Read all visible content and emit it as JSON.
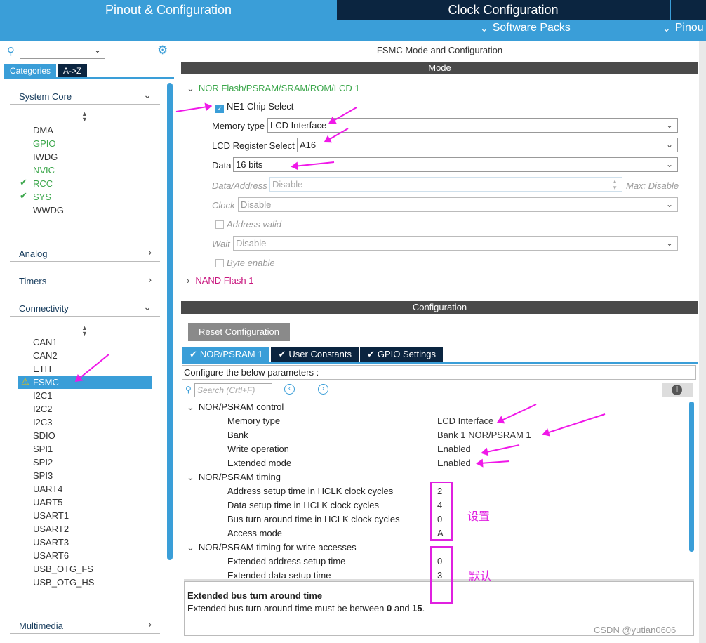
{
  "tabs": {
    "pinout": "Pinout & Configuration",
    "clock": "Clock Configuration",
    "software_packs": "Software Packs",
    "pinout_view": "Pinou"
  },
  "left": {
    "categories": "Categories",
    "az": "A->Z",
    "system_core": "System Core",
    "system_items": [
      "DMA",
      "GPIO",
      "IWDG",
      "NVIC",
      "RCC",
      "SYS",
      "WWDG"
    ],
    "analog": "Analog",
    "timers": "Timers",
    "connectivity": "Connectivity",
    "conn_items": [
      "CAN1",
      "CAN2",
      "ETH",
      "FSMC",
      "I2C1",
      "I2C2",
      "I2C3",
      "SDIO",
      "SPI1",
      "SPI2",
      "SPI3",
      "UART4",
      "UART5",
      "USART1",
      "USART2",
      "USART3",
      "USART6",
      "USB_OTG_FS",
      "USB_OTG_HS"
    ],
    "multimedia": "Multimedia"
  },
  "mode": {
    "title": "FSMC Mode and Configuration",
    "header": "Mode",
    "nor": "NOR Flash/PSRAM/SRAM/ROM/LCD 1",
    "ne1": "NE1 Chip Select",
    "memtype_label": "Memory type",
    "memtype": "LCD Interface",
    "lcdreg_label": "LCD Register Select",
    "lcdreg": "A16",
    "data_label": "Data",
    "data": "16 bits",
    "dataaddr_label": "Data/Address",
    "dataaddr": "Disable",
    "max": "Max: Disable",
    "clock_label": "Clock",
    "clock": "Disable",
    "addrvalid": "Address valid",
    "wait_label": "Wait",
    "wait": "Disable",
    "byteenable": "Byte enable",
    "nand": "NAND Flash 1"
  },
  "config": {
    "header": "Configuration",
    "reset": "Reset Configuration",
    "tab1": "NOR/PSRAM 1",
    "tab2": "User Constants",
    "tab3": "GPIO Settings",
    "configure": "Configure the below parameters :",
    "search_placeholder": "Search (Crtl+F)",
    "grp1": "NOR/PSRAM control",
    "p1": "Memory type",
    "v1": "LCD Interface",
    "p2": "Bank",
    "v2": "Bank 1 NOR/PSRAM 1",
    "p3": "Write operation",
    "v3": "Enabled",
    "p4": "Extended mode",
    "v4": "Enabled",
    "grp2": "NOR/PSRAM timing",
    "p5": "Address setup time in HCLK clock cycles",
    "v5": "2",
    "p6": "Data setup time in HCLK clock cycles",
    "v6": "4",
    "p7": "Bus turn around time in HCLK clock cycles",
    "v7": "0",
    "p8": "Access mode",
    "v8": "A",
    "grp3": "NOR/PSRAM timing for write accesses",
    "p9": "Extended address setup time",
    "v9": "0",
    "p10": "Extended data setup time",
    "v10": "3",
    "ann1": "设置",
    "ann2": "默认",
    "desc_title": "Extended bus turn around time",
    "desc_pre": "Extended bus turn around time must be between ",
    "desc_a": "0",
    "desc_mid": " and ",
    "desc_b": "15",
    "desc_post": "."
  },
  "watermark": "CSDN @yutian0606",
  "colors": {
    "accent": "#3a9ed8",
    "dark": "#0b2540",
    "annotation": "#f018e8",
    "green": "#3aa64a"
  }
}
